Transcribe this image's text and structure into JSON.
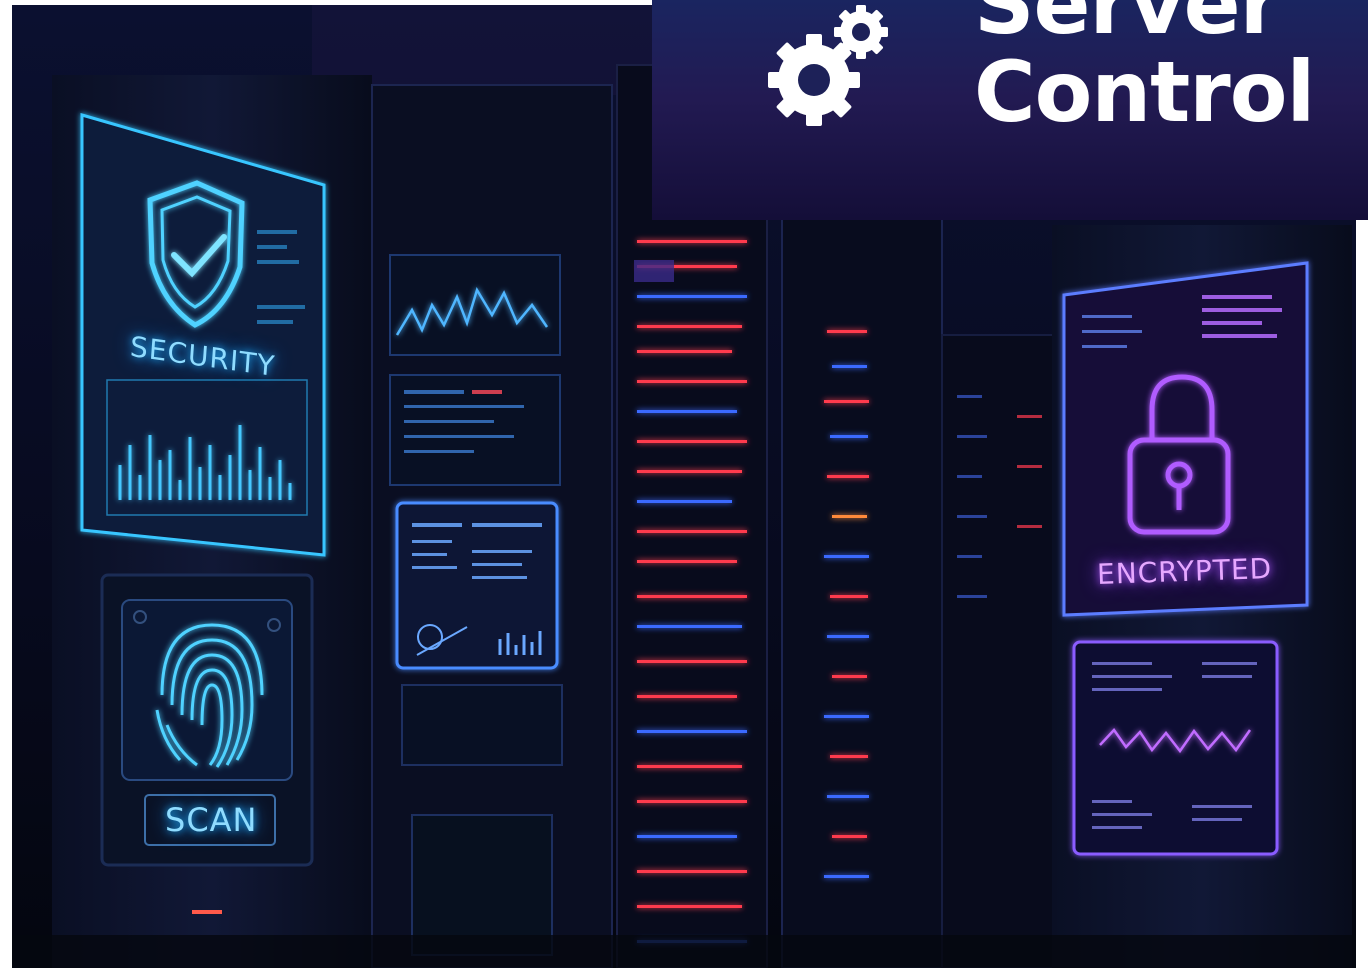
{
  "banner": {
    "title_line1": "Server",
    "title_line2": "Control",
    "icon": "gears-icon"
  },
  "panels": {
    "security": {
      "label": "SECURITY",
      "icon": "shield-check-icon"
    },
    "scan": {
      "label": "SCAN",
      "icon": "fingerprint-icon"
    },
    "encrypted": {
      "label": "ENCRYPTED",
      "icon": "padlock-icon"
    }
  },
  "colors": {
    "cyan_glow": "#1fb4ff",
    "violet_glow": "#b45cff",
    "red_led": "#ff3b4e",
    "blue_led": "#3b6bff",
    "background": "#070a1a"
  }
}
